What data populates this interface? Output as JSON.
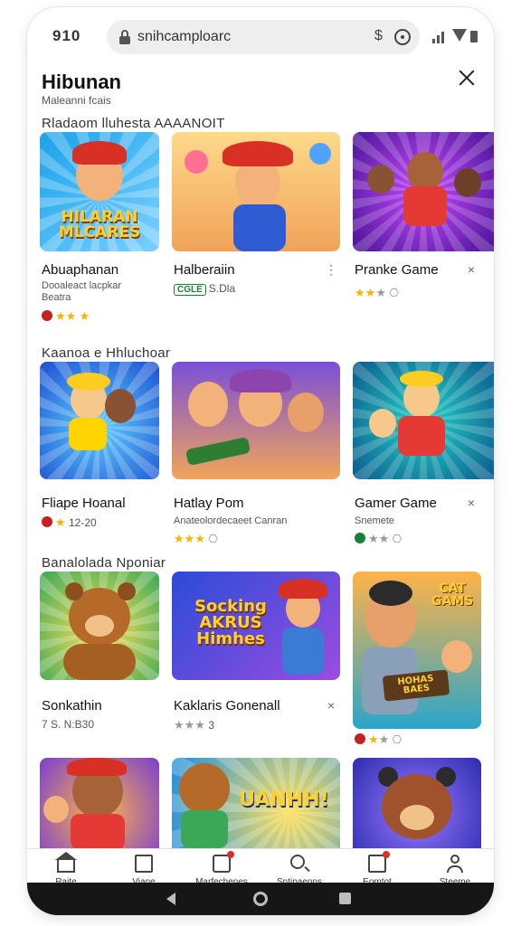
{
  "status": {
    "time": "910"
  },
  "url_bar": {
    "url": "snihcamploarc",
    "dollar": "$"
  },
  "header": {
    "title": "Hibunan",
    "subtitle": "Maleanni fcais"
  },
  "icons": {
    "lock": "lock-icon",
    "reload": "reload-icon",
    "close": "close-icon",
    "more": "more-vert-icon",
    "dismiss": "dismiss-icon"
  },
  "sections": [
    {
      "title": "Rladaom  lluhesta  AAAANOIT",
      "cards": [
        {
          "thumb_text": "HILARAN MLCARES",
          "title": "Abuaphanan",
          "sub": "Dooaleact lacpkar Beatra",
          "rating": "",
          "meta": ""
        },
        {
          "thumb_text": "",
          "title": "Halberaiin",
          "sub": "",
          "badge": "CGLE",
          "meta": "S.Dla"
        },
        {
          "thumb_text": "",
          "title": "Pranke Game",
          "sub": "",
          "meta": ""
        }
      ]
    },
    {
      "title": "Kaanoa e Hhluchoar",
      "cards": [
        {
          "thumb_text": "",
          "title": "Fliape Hoanal",
          "sub": "",
          "meta": "12-20"
        },
        {
          "thumb_text": "",
          "title": "Hatlay Pom",
          "sub": "Anateolordecaeet Canran",
          "meta": ""
        },
        {
          "thumb_text": "",
          "title": "Gamer Game",
          "sub": "Snemete",
          "meta": ""
        }
      ]
    },
    {
      "title": "Banalolada  Nponiar",
      "cards": [
        {
          "thumb_text": "",
          "title": "Sonkathin",
          "sub": "",
          "meta": "7 S. N:B30"
        },
        {
          "thumb_text": "Socking AKRUS Himhes",
          "title": "Kaklaris Gonenall",
          "sub": "",
          "meta": "3"
        },
        {
          "thumb_text": "CAT GAMS",
          "thumb_sign": "HOHAS BAES",
          "title": "",
          "sub": "",
          "meta": ""
        }
      ]
    }
  ],
  "row4": {
    "thumb_text": "UANHH!"
  },
  "bottom_nav": [
    {
      "label": "Raite",
      "icon": "home-icon"
    },
    {
      "label": "Viane",
      "icon": "document-icon"
    },
    {
      "label": "Marfechenes",
      "icon": "shopping-bag-icon"
    },
    {
      "label": "Sntipaenns",
      "icon": "search-icon"
    },
    {
      "label": "Eomtot",
      "icon": "inbox-icon"
    },
    {
      "label": "Steeme",
      "icon": "profile-icon"
    }
  ],
  "colors": {
    "accent_star": "#f4b400",
    "badge_red": "#c5221f",
    "badge_green": "#188038",
    "system_nav": "#161616"
  }
}
